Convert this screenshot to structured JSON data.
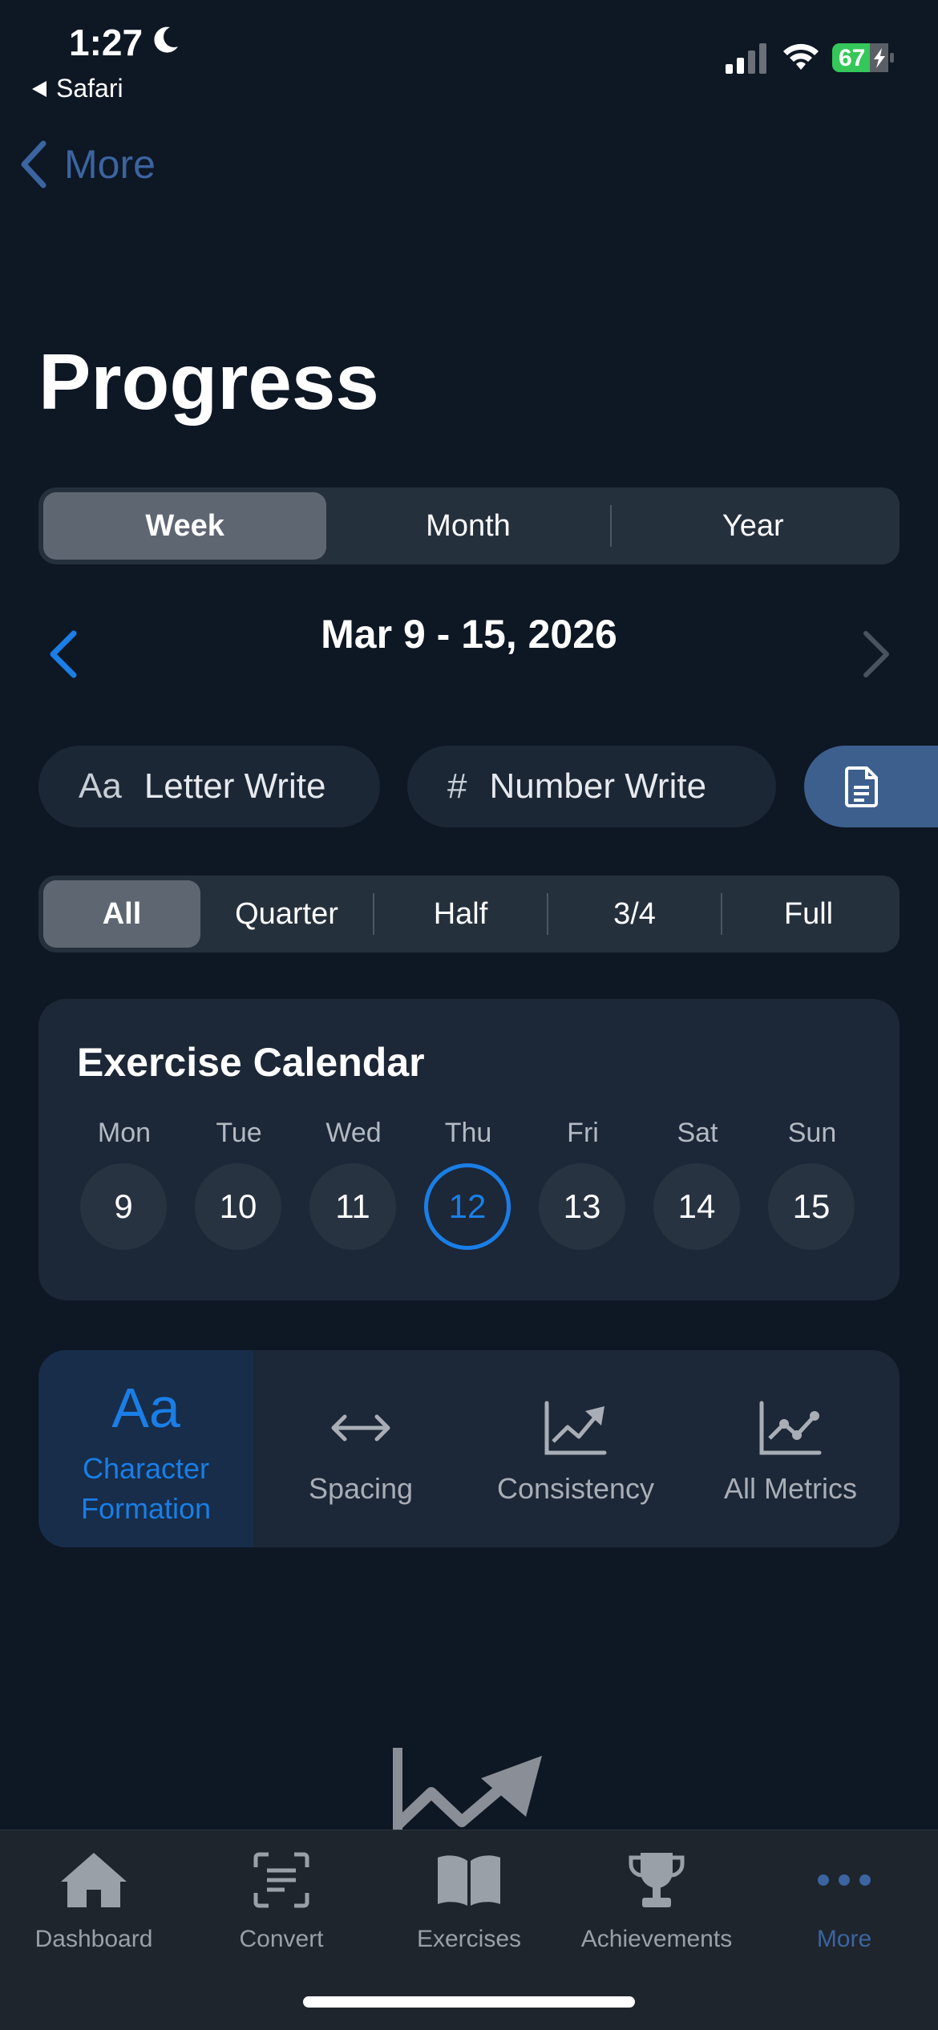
{
  "status_bar": {
    "time": "1:27",
    "back_app": "Safari",
    "battery": "67"
  },
  "nav": {
    "back_label": "More"
  },
  "page": {
    "title": "Progress"
  },
  "period_tabs": [
    {
      "label": "Week",
      "active": true
    },
    {
      "label": "Month",
      "active": false
    },
    {
      "label": "Year",
      "active": false
    }
  ],
  "date_range": "Mar 9 - 15, 2026",
  "mode_chips": {
    "letter": {
      "icon_text": "Aa",
      "label": "Letter Write"
    },
    "number": {
      "icon_text": "#",
      "label": "Number Write"
    },
    "document": {
      "icon": "document-icon"
    }
  },
  "filter_tabs": [
    {
      "label": "All",
      "active": true
    },
    {
      "label": "Quarter",
      "active": false
    },
    {
      "label": "Half",
      "active": false
    },
    {
      "label": "3/4",
      "active": false
    },
    {
      "label": "Full",
      "active": false
    }
  ],
  "calendar": {
    "title": "Exercise Calendar",
    "days": [
      {
        "label": "Mon",
        "num": "9"
      },
      {
        "label": "Tue",
        "num": "10"
      },
      {
        "label": "Wed",
        "num": "11"
      },
      {
        "label": "Thu",
        "num": "12",
        "today": true
      },
      {
        "label": "Fri",
        "num": "13"
      },
      {
        "label": "Sat",
        "num": "14"
      },
      {
        "label": "Sun",
        "num": "15"
      }
    ]
  },
  "metrics": {
    "character": {
      "icon_text": "Aa",
      "line1": "Character",
      "line2": "Formation"
    },
    "spacing": {
      "label": "Spacing"
    },
    "consistency": {
      "label": "Consistency"
    },
    "all": {
      "label": "All Metrics"
    }
  },
  "tabbar": {
    "dashboard": "Dashboard",
    "convert": "Convert",
    "exercises": "Exercises",
    "achievements": "Achievements",
    "more": "More"
  },
  "colors": {
    "background": "#0e1724",
    "accent": "#1a7ee6",
    "card": "#1c2737",
    "tab_active": "#3b64a0"
  }
}
